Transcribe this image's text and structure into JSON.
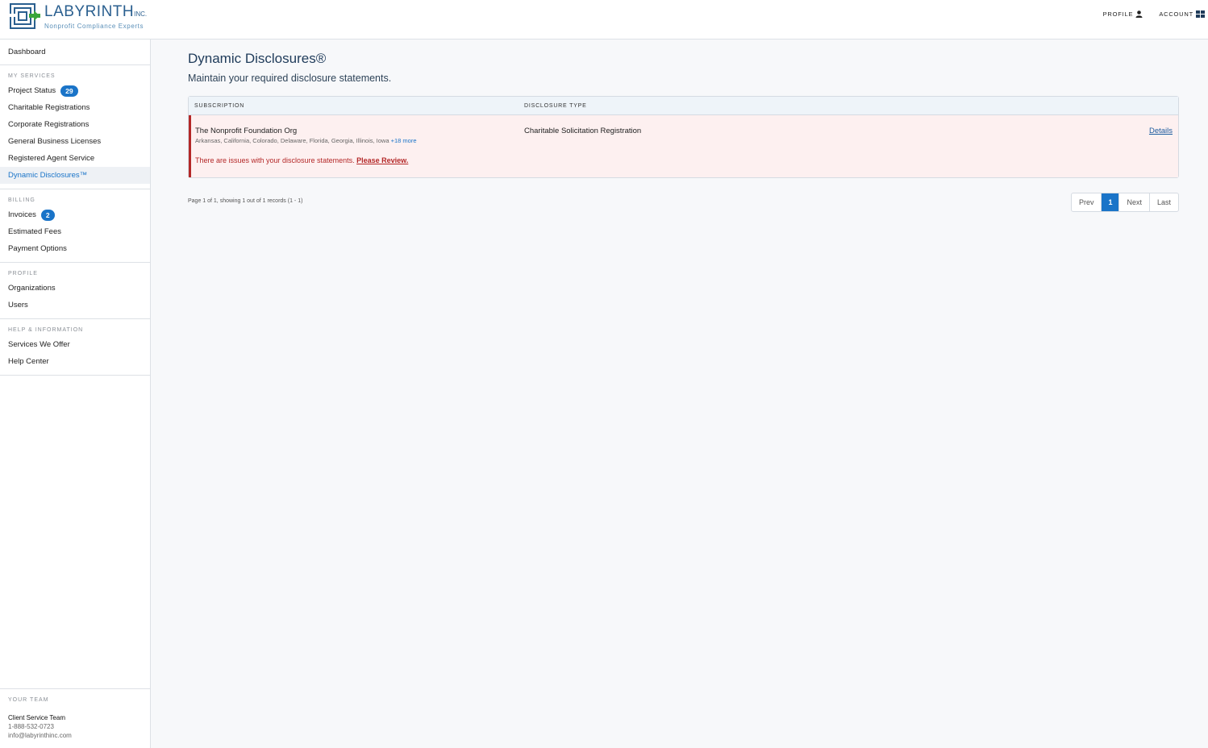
{
  "header": {
    "logo_name": "LABYRINTH",
    "logo_inc": "INC.",
    "logo_tagline": "Nonprofit Compliance Experts",
    "profile_label": "PROFILE",
    "account_label": "ACCOUNT"
  },
  "sidebar": {
    "dashboard": "Dashboard",
    "my_services": {
      "heading": "MY SERVICES",
      "items": [
        {
          "label": "Project Status",
          "badge": "29"
        },
        {
          "label": "Charitable Registrations"
        },
        {
          "label": "Corporate Registrations"
        },
        {
          "label": "General Business Licenses"
        },
        {
          "label": "Registered Agent Service"
        },
        {
          "label": "Dynamic Disclosures™"
        }
      ]
    },
    "billing": {
      "heading": "BILLING",
      "items": [
        {
          "label": "Invoices",
          "badge": "2"
        },
        {
          "label": "Estimated Fees"
        },
        {
          "label": "Payment Options"
        }
      ]
    },
    "profile": {
      "heading": "PROFILE",
      "items": [
        {
          "label": "Organizations"
        },
        {
          "label": "Users"
        }
      ]
    },
    "help": {
      "heading": "HELP & INFORMATION",
      "items": [
        {
          "label": "Services We Offer"
        },
        {
          "label": "Help Center"
        }
      ]
    },
    "team": {
      "heading": "YOUR TEAM",
      "name": "Client Service Team",
      "phone": "1-888-532-0723",
      "email": "info@labyrinthinc.com"
    }
  },
  "main": {
    "title": "Dynamic Disclosures®",
    "subtitle": "Maintain your required disclosure statements.",
    "table": {
      "col_subscription": "SUBSCRIPTION",
      "col_disclosure_type": "DISCLOSURE TYPE",
      "rows": [
        {
          "org": "The Nonprofit Foundation Org",
          "states": "Arkansas, California, Colorado, Delaware, Florida, Georgia, Illinois, Iowa",
          "more": "+18 more",
          "disclosure_type": "Charitable Solicitation Registration",
          "details": "Details",
          "issue_text": "There are issues with your disclosure statements.",
          "issue_link": "Please Review."
        }
      ]
    },
    "pagination": {
      "info": "Page 1 of 1, showing 1 out of 1 records (1 - 1)",
      "prev": "Prev",
      "current": "1",
      "next": "Next",
      "last": "Last"
    }
  },
  "colors": {
    "accent": "#1a74c8",
    "error": "#b42828",
    "error_bg": "#fdf0f0"
  }
}
